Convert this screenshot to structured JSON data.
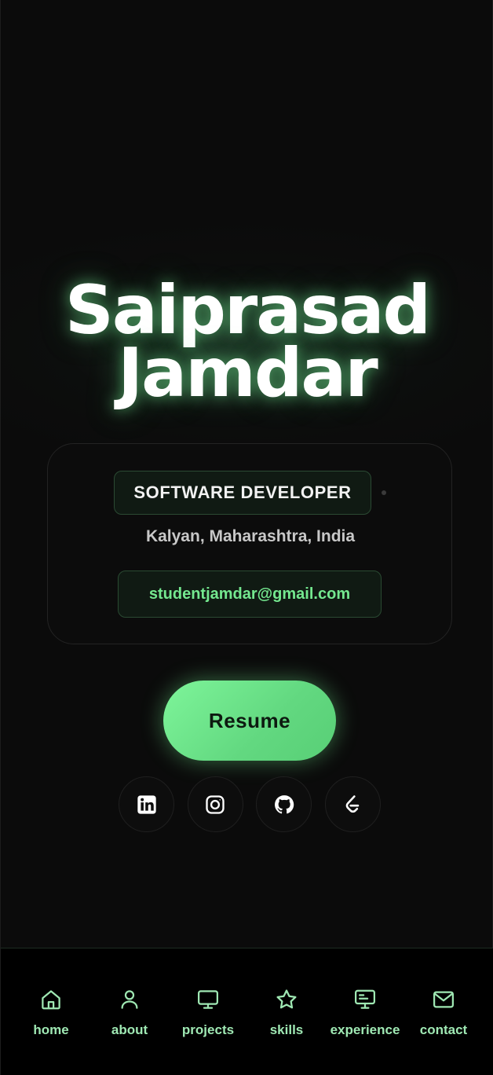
{
  "hero": {
    "first_name": "Saiprasad",
    "last_name": "Jamdar"
  },
  "card": {
    "role": "SOFTWARE DEVELOPER",
    "location": "Kalyan, Maharashtra, India",
    "email": "studentjamdar@gmail.com"
  },
  "resume_label": "Resume",
  "socials": [
    {
      "icon": "linkedin-icon"
    },
    {
      "icon": "instagram-icon"
    },
    {
      "icon": "github-icon"
    },
    {
      "icon": "leetcode-icon"
    }
  ],
  "nav": [
    {
      "label": "home",
      "icon": "home-icon"
    },
    {
      "label": "about",
      "icon": "user-icon"
    },
    {
      "label": "projects",
      "icon": "monitor-icon"
    },
    {
      "label": "skills",
      "icon": "star-icon"
    },
    {
      "label": "experience",
      "icon": "presentation-icon"
    },
    {
      "label": "contact",
      "icon": "mail-icon"
    }
  ],
  "colors": {
    "accent": "#74e88f",
    "nav_label": "#9fe8b3",
    "background": "#0b0b0b"
  }
}
